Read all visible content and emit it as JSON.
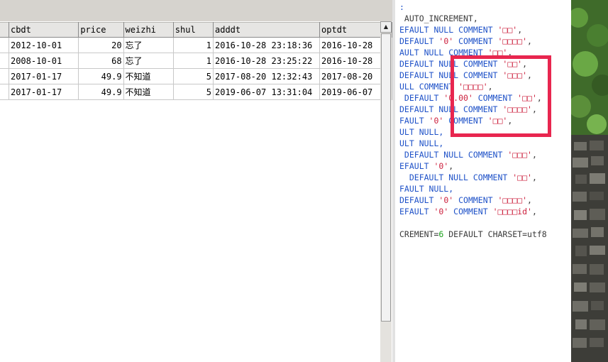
{
  "grid": {
    "columns": [
      "cbdt",
      "price",
      "weizhi",
      "shul",
      "adddt",
      "optdt"
    ],
    "rows": [
      {
        "cbdt": "2012-10-01",
        "price": "20",
        "weizhi": "忘了",
        "shul": "1",
        "adddt": "2016-10-28 23:18:36",
        "optdt": "2016-10-28"
      },
      {
        "cbdt": "2008-10-01",
        "price": "68",
        "weizhi": "忘了",
        "shul": "1",
        "adddt": "2016-10-28 23:25:22",
        "optdt": "2016-10-28"
      },
      {
        "cbdt": "2017-01-17",
        "price": "49.9",
        "weizhi": "不知道",
        "shul": "5",
        "adddt": "2017-08-20 12:32:43",
        "optdt": "2017-08-20"
      },
      {
        "cbdt": "2017-01-17",
        "price": "49.9",
        "weizhi": "不知道",
        "shul": "5",
        "adddt": "2019-06-07 13:31:04",
        "optdt": "2019-06-07"
      }
    ]
  },
  "scrollbar": {
    "up_glyph": "▲"
  },
  "ddl": {
    "lines": [
      [
        {
          "t": ":",
          "c": "k"
        }
      ],
      [
        {
          "t": " AUTO_INCREMENT,",
          "c": "p"
        }
      ],
      [
        {
          "t": "EFAULT NULL COMMENT ",
          "c": "k"
        },
        {
          "t": "'□□'",
          "c": "s"
        },
        {
          "t": ",",
          "c": "p"
        }
      ],
      [
        {
          "t": "DEFAULT ",
          "c": "k"
        },
        {
          "t": "'0'",
          "c": "s"
        },
        {
          "t": " COMMENT ",
          "c": "k"
        },
        {
          "t": "'□□□□'",
          "c": "s"
        },
        {
          "t": ",",
          "c": "p"
        }
      ],
      [
        {
          "t": "AULT NULL COMMENT ",
          "c": "k"
        },
        {
          "t": "'□□'",
          "c": "s"
        },
        {
          "t": ",",
          "c": "p"
        }
      ],
      [
        {
          "t": "DEFAULT NULL COMMENT ",
          "c": "k"
        },
        {
          "t": "'□□'",
          "c": "s"
        },
        {
          "t": ",",
          "c": "p"
        }
      ],
      [
        {
          "t": "DEFAULT NULL COMMENT ",
          "c": "k"
        },
        {
          "t": "'□□□'",
          "c": "s"
        },
        {
          "t": ",",
          "c": "p"
        }
      ],
      [
        {
          "t": "ULL COMMENT ",
          "c": "k"
        },
        {
          "t": "'□□□□'",
          "c": "s"
        },
        {
          "t": ",",
          "c": "p"
        }
      ],
      [
        {
          "t": " DEFAULT ",
          "c": "k"
        },
        {
          "t": "'0.00'",
          "c": "s"
        },
        {
          "t": " COMMENT ",
          "c": "k"
        },
        {
          "t": "'□□'",
          "c": "s"
        },
        {
          "t": ",",
          "c": "p"
        }
      ],
      [
        {
          "t": "DEFAULT NULL COMMENT ",
          "c": "k"
        },
        {
          "t": "'□□□□'",
          "c": "s"
        },
        {
          "t": ",",
          "c": "p"
        }
      ],
      [
        {
          "t": "FAULT ",
          "c": "k"
        },
        {
          "t": "'0'",
          "c": "s"
        },
        {
          "t": " COMMENT ",
          "c": "k"
        },
        {
          "t": "'□□'",
          "c": "s"
        },
        {
          "t": ",",
          "c": "p"
        }
      ],
      [
        {
          "t": "ULT NULL,",
          "c": "k"
        }
      ],
      [
        {
          "t": "ULT NULL,",
          "c": "k"
        }
      ],
      [
        {
          "t": " DEFAULT NULL COMMENT ",
          "c": "k"
        },
        {
          "t": "'□□□'",
          "c": "s"
        },
        {
          "t": ",",
          "c": "p"
        }
      ],
      [
        {
          "t": "EFAULT ",
          "c": "k"
        },
        {
          "t": "'0'",
          "c": "s"
        },
        {
          "t": ",",
          "c": "p"
        }
      ],
      [
        {
          "t": "  DEFAULT NULL COMMENT ",
          "c": "k"
        },
        {
          "t": "'□□'",
          "c": "s"
        },
        {
          "t": ",",
          "c": "p"
        }
      ],
      [
        {
          "t": "FAULT NULL,",
          "c": "k"
        }
      ],
      [
        {
          "t": "DEFAULT ",
          "c": "k"
        },
        {
          "t": "'0'",
          "c": "s"
        },
        {
          "t": " COMMENT ",
          "c": "k"
        },
        {
          "t": "'□□□□'",
          "c": "s"
        },
        {
          "t": ",",
          "c": "p"
        }
      ],
      [
        {
          "t": "EFAULT ",
          "c": "k"
        },
        {
          "t": "'0'",
          "c": "s"
        },
        {
          "t": " COMMENT ",
          "c": "k"
        },
        {
          "t": "'□□□□id'",
          "c": "s"
        },
        {
          "t": ",",
          "c": "p"
        }
      ],
      [],
      [
        {
          "t": "CREMENT=",
          "c": "p"
        },
        {
          "t": "6",
          "c": "n"
        },
        {
          "t": " DEFAULT CHARSET=utf8",
          "c": "p"
        }
      ]
    ]
  },
  "colors": {
    "highlight": "#e8264f",
    "keyword": "#1f52c8",
    "string": "#cc1f3c",
    "number": "#1aa11a"
  }
}
